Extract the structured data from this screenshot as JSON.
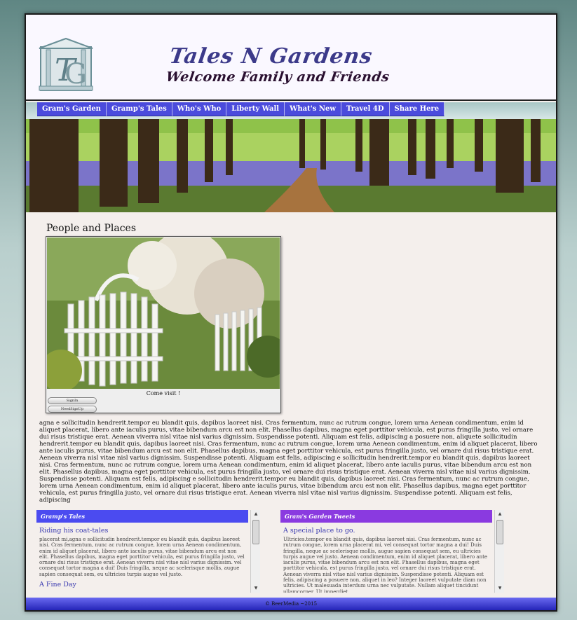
{
  "header": {
    "title": "Tales N Gardens",
    "subtitle": "Welcome Family and Friends"
  },
  "nav": {
    "items": [
      "Gram's Garden",
      "Gramp's Tales",
      "Who's Who",
      "Liberty Wall",
      "What's New",
      "Travel 4D",
      "Share Here"
    ]
  },
  "main": {
    "heading": "People and Places",
    "photo_caption": "Come visit !",
    "btn_signin": "SignIn",
    "btn_needsignup": "NeedSignUp",
    "body_text": "agna e sollicitudin hendrerit.tempor eu blandit quis, dapibus laoreet nisi. Cras fermentum, nunc ac rutrum congue, lorem urna Aenean condimentum, enim id aliquet placerat, libero ante iaculis purus, vitae bibendum arcu est non elit. Phasellus dapibus, magna eget porttitor vehicula, est purus fringilla justo, vel ornare dui risus tristique erat. Aenean viverra nisl vitae nisl varius dignissim. Suspendisse potenti. Aliquam est felis, adipiscing a posuere non, aliquete sollicitudin hendrerit.tempor eu blandit quis, dapibus laoreet nisi. Cras fermentum, nunc ac rutrum congue, lorem urna Aenean condimentum, enim id aliquet placerat, libero ante iaculis purus, vitae bibendum arcu est non elit. Phasellus dapibus, magna eget porttitor vehicula, est purus fringilla justo, vel ornare dui risus tristique erat. Aenean viverra nisl vitae nisl varius dignissim. Suspendisse potenti. Aliquam est felis, adipiscing e sollicitudin hendrerit.tempor eu blandit quis, dapibus laoreet nisi. Cras fermentum, nunc ac rutrum congue, lorem urna Aenean condimentum, enim id aliquet placerat, libero ante iaculis purus, vitae bibendum arcu est non elit. Phasellus dapibus, magna eget porttitor vehicula, est purus fringilla justo, vel ornare dui risus tristique erat. Aenean viverra nisl vitae nisl varius dignissim. Suspendisse potenti. Aliquam est felis, adipiscing e sollicitudin hendrerit.tempor eu blandit quis, dapibus laoreet nisi. Cras fermentum, nunc ac rutrum congue, lorem urna Aenean condimentum, enim id aliquet placerat, libero ante iaculis purus, vitae bibendum arcu est non elit. Phasellus dapibus, magna eget porttitor vehicula, est purus fringilla justo, vel ornare dui risus tristique erat. Aenean viverra nisl vitae nisl varius dignissim. Suspendisse potenti. Aliquam est felis, adipiscing"
  },
  "left_col": {
    "header": "Gramp's Tales",
    "post_title": "Riding his coat-tales",
    "post_text": "placerat mi,agna e sollicitudin hendrerit.tempor eu blandit quis, dapibus laoreet nisi. Cras fermentum, nunc ac rutrum congue, lorem urna Aenean condimentum, enim id aliquet placerat, libero ante iaculis purus, vitae bibendum arcu est non elit. Phasellus dapibus, magna eget porttitor vehicula, est purus fringilla justo, vel ornare dui risus tristique erat. Aenean viverra nisl vitae nisl varius dignissim. vel consequat tortor magna a dui! Duis fringilla, neque ac scelerisque mollis, augue sapien consequat sem, eu ultricies turpis augue vel justo.",
    "post_title2": "A Fine Day",
    "color": "#4b4bf0"
  },
  "right_col": {
    "header": "Gram's Garden Tweets",
    "post_title": "A special place to go.",
    "post_text": "Ultricies.tempor eu blandit quis, dapibus laoreet nisi. Cras fermentum, nunc ac rutrum congue, lorem urna placerat mi, vel consequat tortor magna a dui! Duis fringilla, neque ac scelerisque mollis, augue sapien consequat sem, eu ultricies turpis augue vel justo. Aenean condimentum, enim id aliquet placerat, libero ante iaculis purus, vitae bibendum arcu est non elit. Phasellus dapibus, magna eget porttitor vehicula, est purus fringilla justo, vel ornare dui risus tristique erat. Aenean viverra nisl vitae nisl varius dignissim. Suspendisse potenti. Aliquam est felis, adipiscing a posuere non, aliquet in leo? Integer laoreet vulputate diam non ultricies. Ut malesuada interdum urna nec vulputate. Nullam aliquet tincidunt ullamcorper. Ut imperdiet",
    "color": "#8a3ae0"
  },
  "footer": {
    "text": "© BeerMedia ~2015"
  }
}
